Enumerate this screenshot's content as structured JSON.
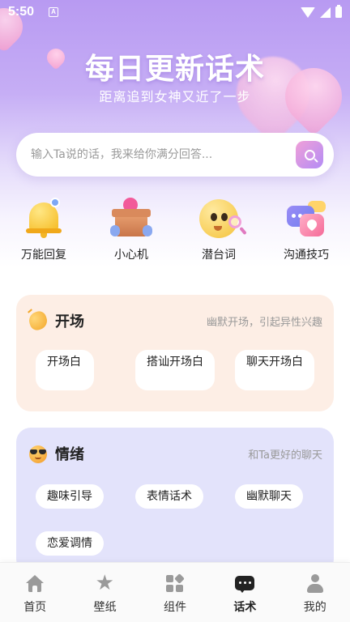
{
  "status_bar": {
    "time": "5:50",
    "notification_letter": "A"
  },
  "hero": {
    "title": "每日更新话术",
    "subtitle": "距离追到女神又近了一步"
  },
  "search": {
    "placeholder": "输入Ta说的话，我来给你满分回答..."
  },
  "features": [
    {
      "label": "万能回复",
      "icon": "bell-icon"
    },
    {
      "label": "小心机",
      "icon": "gift-box-icon"
    },
    {
      "label": "潜台词",
      "icon": "magnifier-face-icon"
    },
    {
      "label": "沟通技巧",
      "icon": "chat-bubbles-icon"
    }
  ],
  "cards": [
    {
      "title": "开场",
      "description": "幽默开场，引起异性兴趣",
      "icon": "clapping-hands-icon",
      "background": "#fdeee5",
      "chips": [
        "开场白",
        "搭讪开场白",
        "聊天开场白"
      ]
    },
    {
      "title": "情绪",
      "description": "和Ta更好的聊天",
      "icon": "sunglasses-face-icon",
      "background": "#e3e3fb",
      "chips": [
        "趣味引导",
        "表情话术",
        "幽默聊天",
        "恋爱调情"
      ]
    }
  ],
  "nav": {
    "active": "话术",
    "items": [
      {
        "label": "首页",
        "icon": "home-icon"
      },
      {
        "label": "壁纸",
        "icon": "star-icon"
      },
      {
        "label": "组件",
        "icon": "widgets-icon"
      },
      {
        "label": "话术",
        "icon": "chat-icon"
      },
      {
        "label": "我的",
        "icon": "person-icon"
      }
    ]
  },
  "colors": {
    "accent": "#b38cf5",
    "hero_top": "#b89af2",
    "card_open": "#fdeee5",
    "card_emotion": "#e3e3fb"
  }
}
